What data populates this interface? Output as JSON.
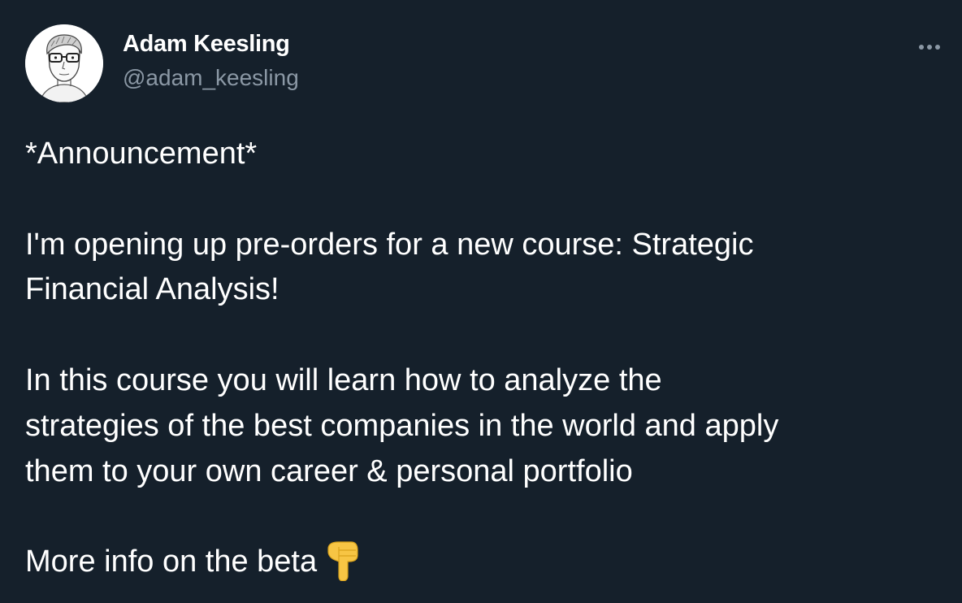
{
  "tweet": {
    "author": {
      "display_name": "Adam Keesling",
      "handle": "@adam_keesling",
      "avatar_icon": "profile-avatar-illustration"
    },
    "more_icon": "ellipsis-icon",
    "text": {
      "line_1": "*Announcement*",
      "line_2": "I'm opening up pre-orders for a new course: Strategic",
      "line_3": "Financial Analysis!",
      "line_4": "In this course you will learn how to analyze the",
      "line_5": "strategies of the best companies in the world and apply",
      "line_6": "them to your own career & personal portfolio",
      "line_7": "More info on the beta"
    },
    "emoji_icon": "pointing-down-hand-emoji",
    "colors": {
      "background": "#15202b",
      "primary_text": "#ffffff",
      "secondary_text": "#8b98a5",
      "emoji": "#f7c544"
    }
  }
}
